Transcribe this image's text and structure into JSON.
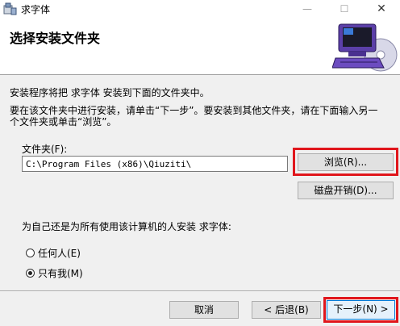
{
  "window": {
    "title": "求字体",
    "minimize": "—",
    "maximize": "☐",
    "close": "✕"
  },
  "header": {
    "title": "选择安装文件夹"
  },
  "body": {
    "line1": "安装程序将把 求字体 安装到下面的文件夹中。",
    "line2": "要在该文件夹中进行安装，请单击“下一步”。要安装到其他文件夹，请在下面输入另一",
    "line3": "个文件夹或单击“浏览”。"
  },
  "folder": {
    "label": "文件夹(F):",
    "value": "C:\\Program Files (x86)\\Qiuziti\\"
  },
  "buttons": {
    "browse": "浏览(R)...",
    "disk_cost": "磁盘开销(D)...",
    "cancel": "取消",
    "back": "< 后退(B)",
    "next": "下一步(N) >"
  },
  "install_for": {
    "question": "为自己还是为所有使用该计算机的人安装 求字体:",
    "options": [
      {
        "label": "任何人(E)",
        "selected": false
      },
      {
        "label": "只有我(M)",
        "selected": true
      }
    ]
  },
  "colors": {
    "highlight": "#e0161c",
    "accent": "#0078d7"
  }
}
